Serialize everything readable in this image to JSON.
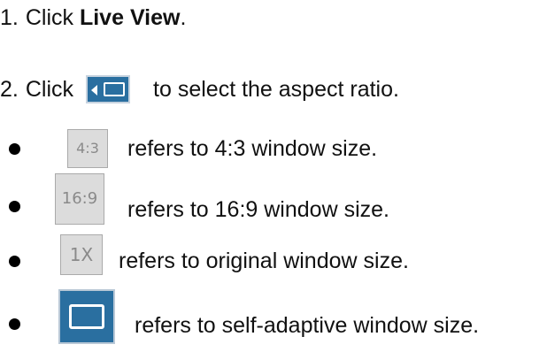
{
  "steps": [
    {
      "num": "1.",
      "prefix": "Click ",
      "bold": "Live View",
      "suffix": "."
    },
    {
      "num": "2.",
      "prefix": "Click",
      "suffix": "to select the aspect ratio.",
      "icon": "aspect-ratio-icon"
    }
  ],
  "bullets": [
    {
      "icon_text": "4:3",
      "text": "refers to 4:3 window size."
    },
    {
      "icon_text": "16:9",
      "text": "refers to 16:9 window size."
    },
    {
      "icon_text": "1X",
      "text": "refers to original window size."
    },
    {
      "icon_text": "",
      "text": "refers to self-adaptive window size.",
      "icon": "self-adaptive-icon"
    }
  ]
}
